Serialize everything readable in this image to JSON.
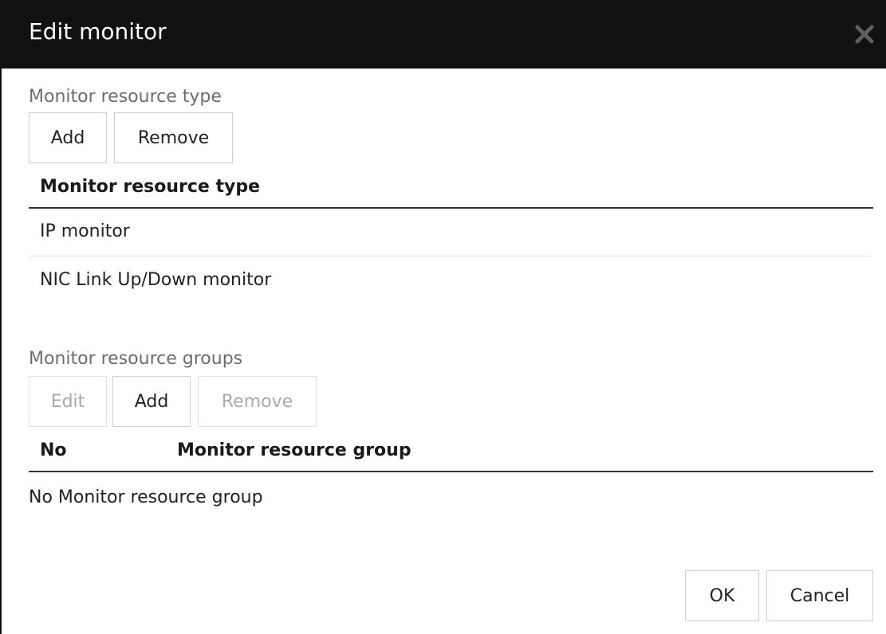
{
  "dialog": {
    "title": "Edit monitor",
    "close_icon": "close-icon"
  },
  "type_section": {
    "label": "Monitor resource type",
    "add_label": "Add",
    "remove_label": "Remove",
    "column_header": "Monitor resource type",
    "rows": [
      "IP monitor",
      "NIC Link Up/Down monitor"
    ]
  },
  "group_section": {
    "label": "Monitor resource groups",
    "edit_label": "Edit",
    "add_label": "Add",
    "remove_label": "Remove",
    "columns": [
      "No",
      "Monitor resource group"
    ],
    "empty_text": "No Monitor resource group"
  },
  "footer": {
    "ok_label": "OK",
    "cancel_label": "Cancel"
  }
}
